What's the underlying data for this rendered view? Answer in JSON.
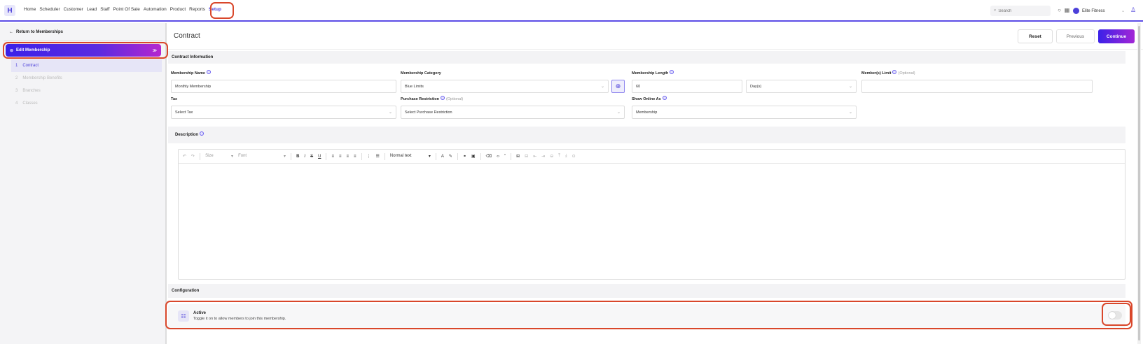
{
  "nav": {
    "logo": "H",
    "items": [
      "Home",
      "Scheduler",
      "Customer",
      "Lead",
      "Staff",
      "Point Of Sale",
      "Automation",
      "Product",
      "Reports",
      "Setup"
    ],
    "active": "Setup",
    "search_placeholder": "Search",
    "branch": "Elite Fitness"
  },
  "sidebar": {
    "return_label": "Return to Memberships",
    "edit_label": "Edit Membership",
    "steps": [
      {
        "num": "1",
        "label": "Contract"
      },
      {
        "num": "2",
        "label": "Membership Benefits"
      },
      {
        "num": "3",
        "label": "Branches"
      },
      {
        "num": "4",
        "label": "Classes"
      }
    ]
  },
  "header": {
    "title": "Contract",
    "reset": "Reset",
    "previous": "Previous",
    "continue": "Continue"
  },
  "contract": {
    "section_title": "Contract Information",
    "membership_name_label": "Membership Name",
    "membership_name_value": "Monthly Membership",
    "category_label": "Membership Category",
    "category_value": "Blue Limits",
    "length_label": "Membership Length",
    "length_value": "60",
    "length_unit": "Day(s)",
    "member_limit_label": "Member(s) Limit",
    "member_limit_optional": "(Optional)",
    "tax_label": "Tax",
    "tax_value": "Select Tax",
    "purchase_label": "Purchase Restriction",
    "purchase_optional": "(Optional)",
    "purchase_value": "Select Purchase Restriction",
    "show_online_label": "Show Online As",
    "show_online_value": "Membership"
  },
  "description": {
    "title": "Description",
    "toolbar": {
      "size": "Size",
      "font": "Font",
      "paragraph": "Normal text"
    }
  },
  "configuration": {
    "title": "Configuration",
    "active_title": "Active",
    "active_desc": "Toggle it on to allow members to join this membership.",
    "active_on": false
  }
}
